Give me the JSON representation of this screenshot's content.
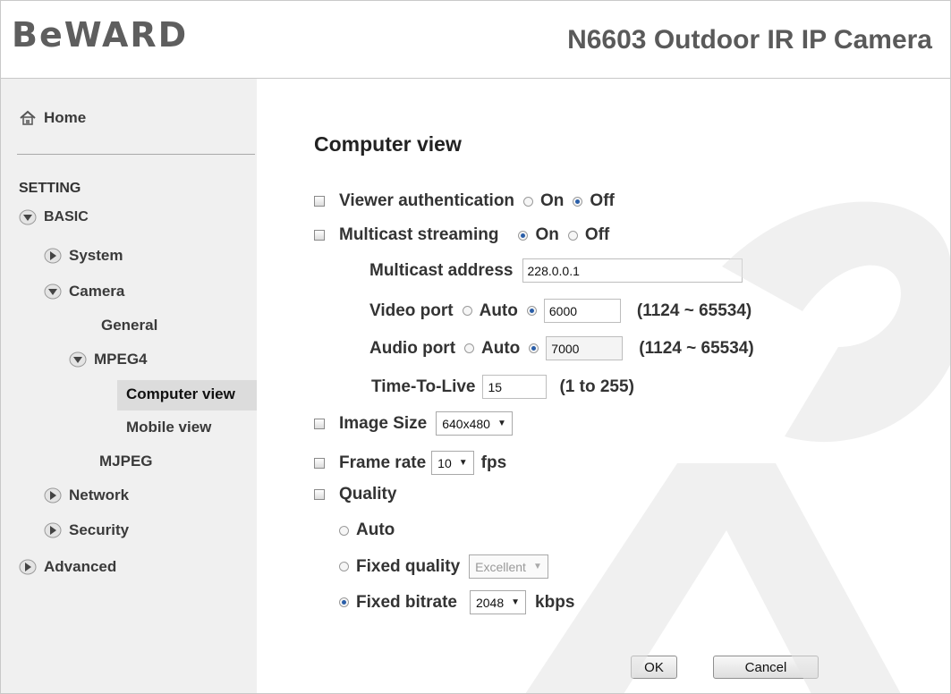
{
  "brand": {
    "logo": "BeWARD",
    "camera_title": "N6603 Outdoor IR IP Camera"
  },
  "sidebar": {
    "home": "Home",
    "section": "SETTING",
    "basic": "BASIC",
    "system": "System",
    "camera": "Camera",
    "general": "General",
    "mpeg4": "MPEG4",
    "computer_view": "Computer view",
    "mobile_view": "Mobile view",
    "mjpeg": "MJPEG",
    "network": "Network",
    "security": "Security",
    "advanced": "Advanced"
  },
  "form": {
    "title": "Computer view",
    "viewer_auth": {
      "label": "Viewer authentication",
      "on": "On",
      "off": "Off",
      "selected": "Off"
    },
    "multicast": {
      "label": "Multicast streaming",
      "on": "On",
      "off": "Off",
      "selected": "On"
    },
    "multicast_address": {
      "label": "Multicast address",
      "value": "228.0.0.1"
    },
    "video_port": {
      "label": "Video port",
      "auto": "Auto",
      "value": "6000",
      "range": "(1124 ~ 65534)"
    },
    "audio_port": {
      "label": "Audio port",
      "auto": "Auto",
      "value": "7000",
      "range": "(1124 ~ 65534)"
    },
    "ttl": {
      "label": "Time-To-Live",
      "value": "15",
      "range": "(1 to 255)"
    },
    "image_size": {
      "label": "Image Size",
      "value": "640x480"
    },
    "frame_rate": {
      "label": "Frame rate",
      "value": "10",
      "unit": "fps"
    },
    "quality": {
      "label": "Quality",
      "auto": "Auto",
      "fixed_quality": "Fixed quality",
      "fixed_quality_value": "Excellent",
      "fixed_bitrate": "Fixed bitrate",
      "bitrate_value": "2048",
      "bitrate_unit": "kbps",
      "selected": "Fixed bitrate"
    },
    "ok": "OK",
    "cancel": "Cancel"
  },
  "icons": {
    "home": "home-icon",
    "expand": "chevron-down-icon",
    "collapse": "chevron-right-icon"
  },
  "colors": {
    "radio_dot": "#2a5ea8",
    "sidebar_bg": "#f0f0f0",
    "selected_bg": "#dcdcdc"
  }
}
